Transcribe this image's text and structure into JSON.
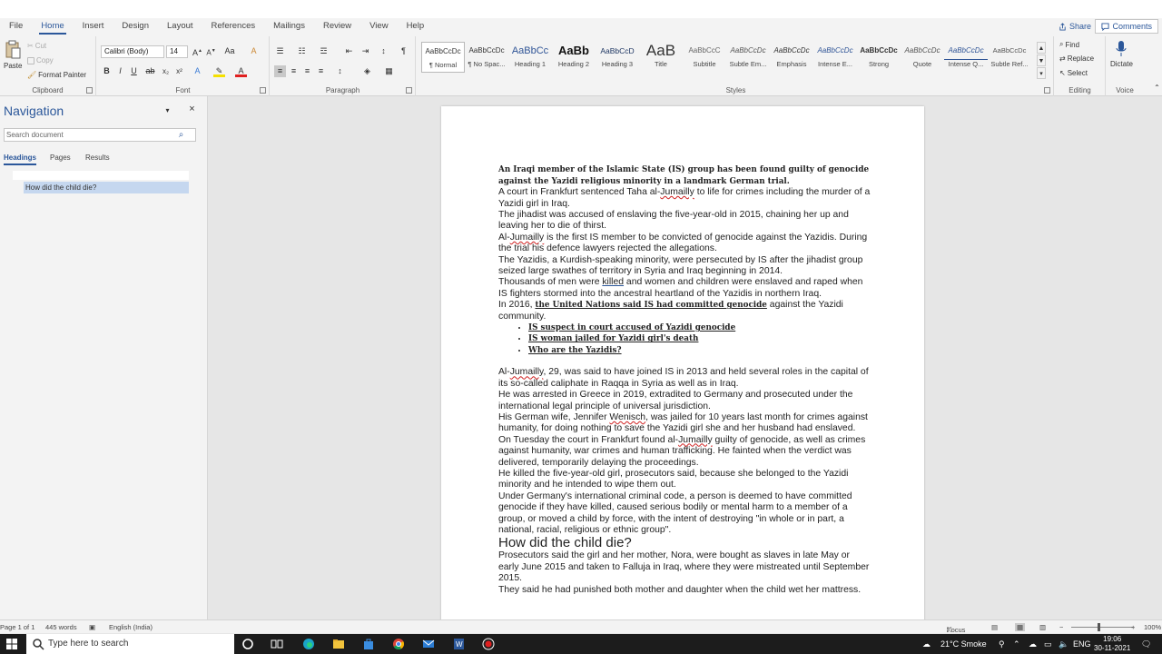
{
  "menu": {
    "tabs": [
      "File",
      "Home",
      "Insert",
      "Design",
      "Layout",
      "References",
      "Mailings",
      "Review",
      "View",
      "Help"
    ],
    "active": "Home",
    "share": "Share",
    "comments": "Comments"
  },
  "ribbon": {
    "clipboard": {
      "label": "Clipboard",
      "paste": "Paste",
      "cut": "Cut",
      "copy": "Copy",
      "format_painter": "Format Painter"
    },
    "font": {
      "label": "Font",
      "family": "Calibri (Body)",
      "size": "14",
      "change_case": "Aa"
    },
    "paragraph": {
      "label": "Paragraph"
    },
    "styles": {
      "label": "Styles",
      "items": [
        {
          "sample": "AaBbCcDc",
          "name": "¶ Normal"
        },
        {
          "sample": "AaBbCcDc",
          "name": "¶ No Spac..."
        },
        {
          "sample": "AaBbCc",
          "name": "Heading 1"
        },
        {
          "sample": "AaBb",
          "name": "Heading 2"
        },
        {
          "sample": "AaBbCcD",
          "name": "Heading 3"
        },
        {
          "sample": "AaB",
          "name": "Title"
        },
        {
          "sample": "AaBbCcC",
          "name": "Subtitle"
        },
        {
          "sample": "AaBbCcDc",
          "name": "Subtle Em..."
        },
        {
          "sample": "AaBbCcDc",
          "name": "Emphasis"
        },
        {
          "sample": "AaBbCcDc",
          "name": "Intense E..."
        },
        {
          "sample": "AaBbCcDc",
          "name": "Strong"
        },
        {
          "sample": "AaBbCcDc",
          "name": "Quote"
        },
        {
          "sample": "AaBbCcDc",
          "name": "Intense Q..."
        },
        {
          "sample": "AaBbCcDc",
          "name": "Subtle Ref..."
        }
      ]
    },
    "editing": {
      "label": "Editing",
      "find": "Find",
      "replace": "Replace",
      "select": "Select"
    },
    "voice": {
      "label": "Voice",
      "dictate": "Dictate"
    }
  },
  "nav": {
    "title": "Navigation",
    "search_placeholder": "Search document",
    "tabs": [
      "Headings",
      "Pages",
      "Results"
    ],
    "headings": [
      "How did the child die?"
    ]
  },
  "doc": {
    "lead": "An Iraqi member of the Islamic State (IS) group has been found guilty of genocide against the Yazidi religious minority in a landmark German trial.",
    "p1a": "A court in Frankfurt sentenced Taha al-",
    "jumailly": "Jumailly",
    "p1b": " to life for crimes including the murder of a Yazidi girl in Iraq.",
    "p2": "The jihadist was accused of enslaving the five-year-old in 2015, chaining her up and leaving her to die of thirst.",
    "p3a": "Al-",
    "p3b": " is the first IS member to be convicted of genocide against the Yazidis. During the trial his defence lawyers rejected the allegations.",
    "p4": "The Yazidis, a Kurdish-speaking minority, were persecuted by IS after the jihadist group seized large swathes of territory in Syria and Iraq beginning in 2014.",
    "p5a": "Thousands of men were ",
    "killed": "killed",
    "p5b": " and women and children were enslaved and raped when IS fighters stormed into the ancestral heartland of the Yazidis in northern Iraq.",
    "p6a": "In 2016, ",
    "p6link": "the United Nations said IS had committed genocide",
    "p6b": " against the Yazidi community.",
    "links": [
      "IS suspect in court accused of Yazidi genocide",
      "IS woman jailed for Yazidi girl's death",
      "Who are the Yazidis?"
    ],
    "p7b": ", 29, was said to have joined IS in 2013 and held several roles in the capital of its so-called caliphate in Raqqa in Syria as well as in Iraq.",
    "p8": "He was arrested in Greece in 2019, extradited to Germany and prosecuted under the international legal principle of universal jurisdiction.",
    "p9a": "His German wife, Jennifer ",
    "wenisch": "Wenisch",
    "p9b": ", was jailed for 10 years last month for crimes against humanity, for doing nothing to save the Yazidi girl she and her husband had enslaved.",
    "p10a": "On Tuesday the court in Frankfurt found al-",
    "p10b": " guilty of genocide, as well as crimes against humanity, war crimes and human trafficking. He fainted when the verdict was delivered, temporarily delaying the proceedings.",
    "p11": "He killed the five-year-old girl, prosecutors said, because she belonged to the Yazidi minority and he intended to wipe them out.",
    "p12": "Under Germany's international criminal code, a person is deemed to have committed genocide if they have killed, caused serious bodily or mental harm to a member of a group, or moved a child by force, with the intent of destroying \"in whole or in part, a national, racial, religious or ethnic group\".",
    "heading": "How did the child die?",
    "p13": "Prosecutors said the girl and her mother, Nora, were bought as slaves in late May or early June 2015 and taken to Falluja in Iraq, where they were mistreated until September 2015.",
    "p14": "They said he had punished both mother and daughter when the child wet her mattress."
  },
  "status": {
    "page": "Page 1 of 1",
    "words": "445 words",
    "language": "English (India)",
    "focus": "Focus",
    "zoom": "100%"
  },
  "taskbar": {
    "search_placeholder": "Type here to search",
    "weather": "21°C  Smoke",
    "lang": "ENG",
    "time": "19:06",
    "date": "30-11-2021"
  },
  "colors": {
    "accent": "#2b579a",
    "taskbar": "#1c1c1c",
    "nav_selected": "#c5d7ef"
  }
}
